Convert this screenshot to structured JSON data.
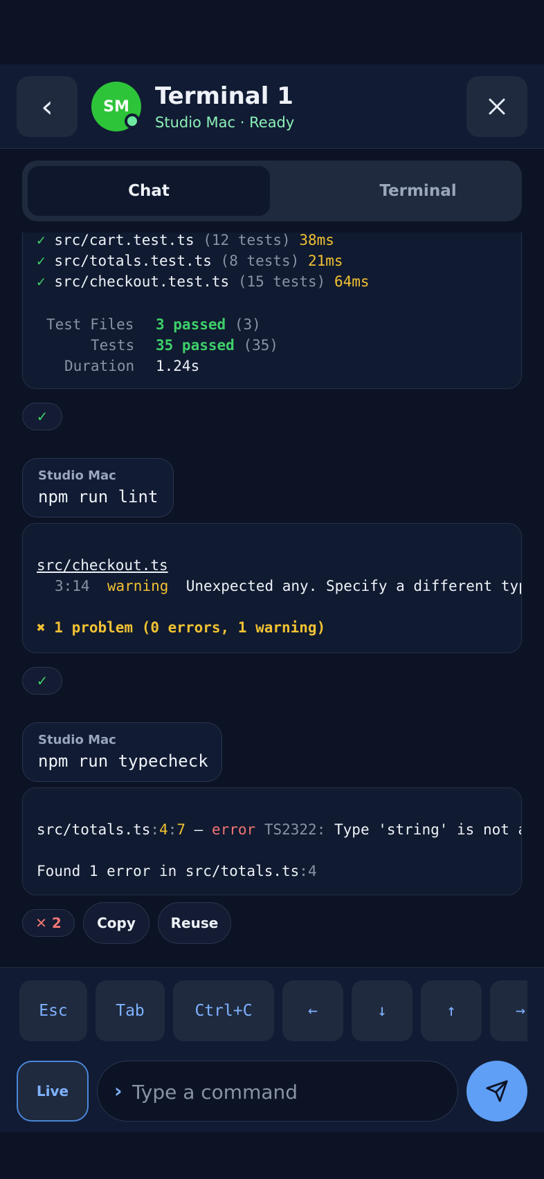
{
  "header": {
    "back_label": "‹",
    "avatar_initials": "SM",
    "title": "Terminal 1",
    "subtitle": "Studio Mac · Ready"
  },
  "tabs": [
    {
      "label": "Chat",
      "selected": true
    },
    {
      "label": "Terminal",
      "selected": false
    }
  ],
  "test_output": {
    "files": [
      {
        "check": "✓",
        "name": "src/cart.test.ts",
        "count": "(12 tests)",
        "time": "38ms"
      },
      {
        "check": "✓",
        "name": "src/totals.test.ts",
        "count": "(8 tests)",
        "time": "21ms"
      },
      {
        "check": "✓",
        "name": "src/checkout.test.ts",
        "count": "(15 tests)",
        "time": "64ms"
      }
    ],
    "summary": [
      {
        "label": "Test Files",
        "value": "3 passed",
        "extra": "(3)"
      },
      {
        "label": "Tests",
        "value": "35 passed",
        "extra": "(35)"
      },
      {
        "label": "Duration",
        "value": "1.24s",
        "extra": ""
      }
    ]
  },
  "status_ok": "✓",
  "lint": {
    "host": "Studio Mac",
    "command": "npm run lint",
    "file": "src/checkout.ts",
    "loc": "3:14",
    "level": "warning",
    "message": "Unexpected any. Specify a different type",
    "summary": "✖ 1 problem (0 errors, 1 warning)"
  },
  "typecheck": {
    "host": "Studio Mac",
    "command": "npm run typecheck",
    "file": "src/totals.ts",
    "line": "4",
    "col": "7",
    "sep1": ":",
    "sep2": ":",
    "dash": "–",
    "level": "error",
    "code": "TS2322:",
    "message": "Type 'string' is not assignable to type 'number'.",
    "found_text": "Found 1 error in src/totals.ts",
    "found_loc": ":4"
  },
  "actions": {
    "error_badge": "✕ 2",
    "copy_label": "Copy",
    "reuse_label": "Reuse"
  },
  "keys": [
    "Esc",
    "Tab",
    "Ctrl+C",
    "←",
    "↓",
    "↑",
    "→"
  ],
  "input": {
    "live_label": "Live",
    "chevron": "›",
    "placeholder": "Type a command"
  }
}
